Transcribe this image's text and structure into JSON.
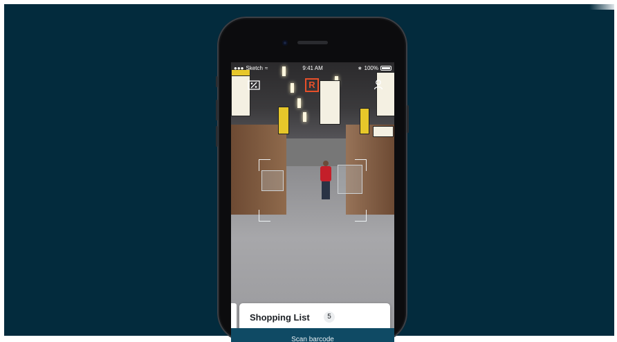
{
  "status_bar": {
    "carrier": "Sketch",
    "time": "9:41 AM",
    "battery": "100%"
  },
  "toolbar": {
    "left_icon": "receipt-percent-icon",
    "logo_text": "R",
    "right_icon": "user-icon"
  },
  "shopping_list": {
    "title": "Shopping List",
    "count": "5"
  },
  "scan_button": {
    "label": "Scan barcode"
  },
  "colors": {
    "background": "#032b3d",
    "brand": "#e8502a",
    "button": "#0f4a64"
  }
}
